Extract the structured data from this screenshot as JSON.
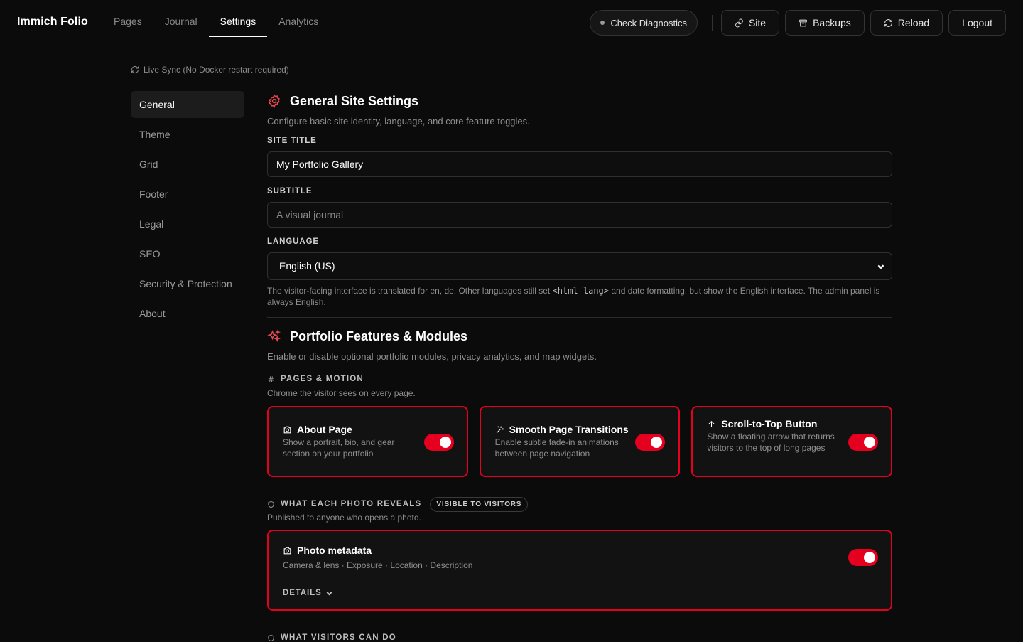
{
  "brand": "Immich Folio",
  "nav": {
    "tabs": [
      "Pages",
      "Journal",
      "Settings",
      "Analytics"
    ],
    "active": "Settings"
  },
  "header_actions": {
    "diagnostics": "Check Diagnostics",
    "site": "Site",
    "backups": "Backups",
    "reload": "Reload",
    "logout": "Logout"
  },
  "sync_status": "Live Sync (No Docker restart required)",
  "sidebar": {
    "items": [
      "General",
      "Theme",
      "Grid",
      "Footer",
      "Legal",
      "SEO",
      "Security & Protection",
      "About"
    ],
    "active": "General"
  },
  "general": {
    "title": "General Site Settings",
    "description": "Configure basic site identity, language, and core feature toggles.",
    "site_title_label": "SITE TITLE",
    "site_title_value": "My Portfolio Gallery",
    "subtitle_label": "SUBTITLE",
    "subtitle_placeholder": "A visual journal",
    "language_label": "LANGUAGE",
    "language_value": "English (US)",
    "language_help_pre": "The visitor-facing interface is translated for en, de. Other languages still set ",
    "language_help_code": "<html lang>",
    "language_help_post": " and date formatting, but show the English interface. The admin panel is always English."
  },
  "features": {
    "title": "Portfolio Features & Modules",
    "description": "Enable or disable optional portfolio modules, privacy analytics, and map widgets.",
    "pages_motion": {
      "heading": "PAGES & MOTION",
      "description": "Chrome the visitor sees on every page.",
      "cards": [
        {
          "title": "About Page",
          "description": "Show a portrait, bio, and gear section on your portfolio",
          "icon": "camera-icon",
          "enabled": true
        },
        {
          "title": "Smooth Page Transitions",
          "description": "Enable subtle fade-in animations between page navigation",
          "icon": "sparkle-icon",
          "enabled": true
        },
        {
          "title": "Scroll-to-Top Button",
          "description": "Show a floating arrow that returns visitors to the top of long pages",
          "icon": "arrow-up-icon",
          "enabled": true
        }
      ]
    },
    "photo_reveals": {
      "heading": "WHAT EACH PHOTO REVEALS",
      "badge": "VISIBLE TO VISITORS",
      "description": "Published to anyone who opens a photo.",
      "metadata_card": {
        "title": "Photo metadata",
        "items": "Camera & lens · Exposure · Location · Description",
        "details_label": "DETAILS",
        "enabled": true
      }
    },
    "visitors_can_do": {
      "heading": "WHAT VISITORS CAN DO"
    }
  },
  "colors": {
    "accent": "#e5001f",
    "background": "#0b0b0b",
    "card": "#121212"
  }
}
